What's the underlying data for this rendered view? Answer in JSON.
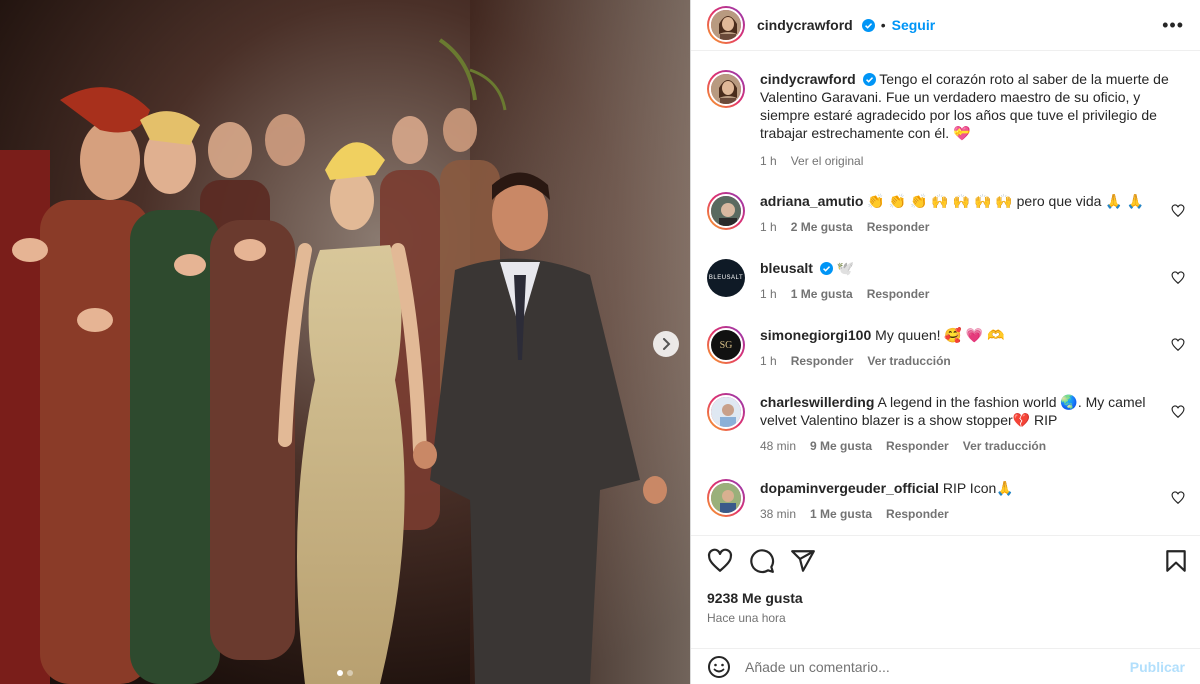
{
  "post": {
    "author": "cindycrawford",
    "follow_label": "Seguir",
    "more_label": "•••",
    "caption": "Tengo el corazón roto al saber de la muerte de Valentino Garavani. Fue un verdadero maestro de su oficio, y siempre estaré agradecido por los años que tuve el privilegio de trabajar estrechamente con él. 💝",
    "caption_time": "1 h",
    "see_original": "Ver el original",
    "likes": "9238 Me gusta",
    "time_ago": "Hace una hora"
  },
  "comments": [
    {
      "user": "adriana_amutio",
      "text": "👏 👏 👏 🙌 🙌 🙌 🙌 pero que vida 🙏 🙏",
      "time": "1 h",
      "likes": "2 Me gusta",
      "reply": "Responder",
      "translate": ""
    },
    {
      "user": "bleusalt",
      "text": "🕊️",
      "time": "1 h",
      "likes": "1 Me gusta",
      "reply": "Responder",
      "translate": "",
      "avatar_text": "BLEUSALT"
    },
    {
      "user": "simonegiorgi100",
      "text": "My quuen! 🥰 💗 🫶",
      "time": "1 h",
      "likes": "",
      "reply": "Responder",
      "translate": "Ver traducción",
      "avatar_text": "SG"
    },
    {
      "user": "charleswillerding",
      "text": "A legend in the fashion world 🌏. My camel velvet Valentino blazer is a show stopper💔  RIP",
      "time": "48 min",
      "likes": "9 Me gusta",
      "reply": "Responder",
      "translate": "Ver traducción"
    },
    {
      "user": "dopaminvergeuder_official",
      "text": "RIP Icon🙏",
      "time": "38 min",
      "likes": "1 Me gusta",
      "reply": "Responder",
      "translate": ""
    }
  ],
  "composer": {
    "placeholder": "Añade un comentario...",
    "publish_label": "Publicar"
  },
  "colors": {
    "accent": "#0095f6",
    "publish_disabled": "#b2dffc",
    "muted": "#737373"
  },
  "icons": [
    "verified-badge-icon",
    "more-options-icon",
    "next-slide-icon",
    "heart-icon",
    "comment-icon",
    "share-icon",
    "bookmark-icon",
    "emoji-icon"
  ]
}
